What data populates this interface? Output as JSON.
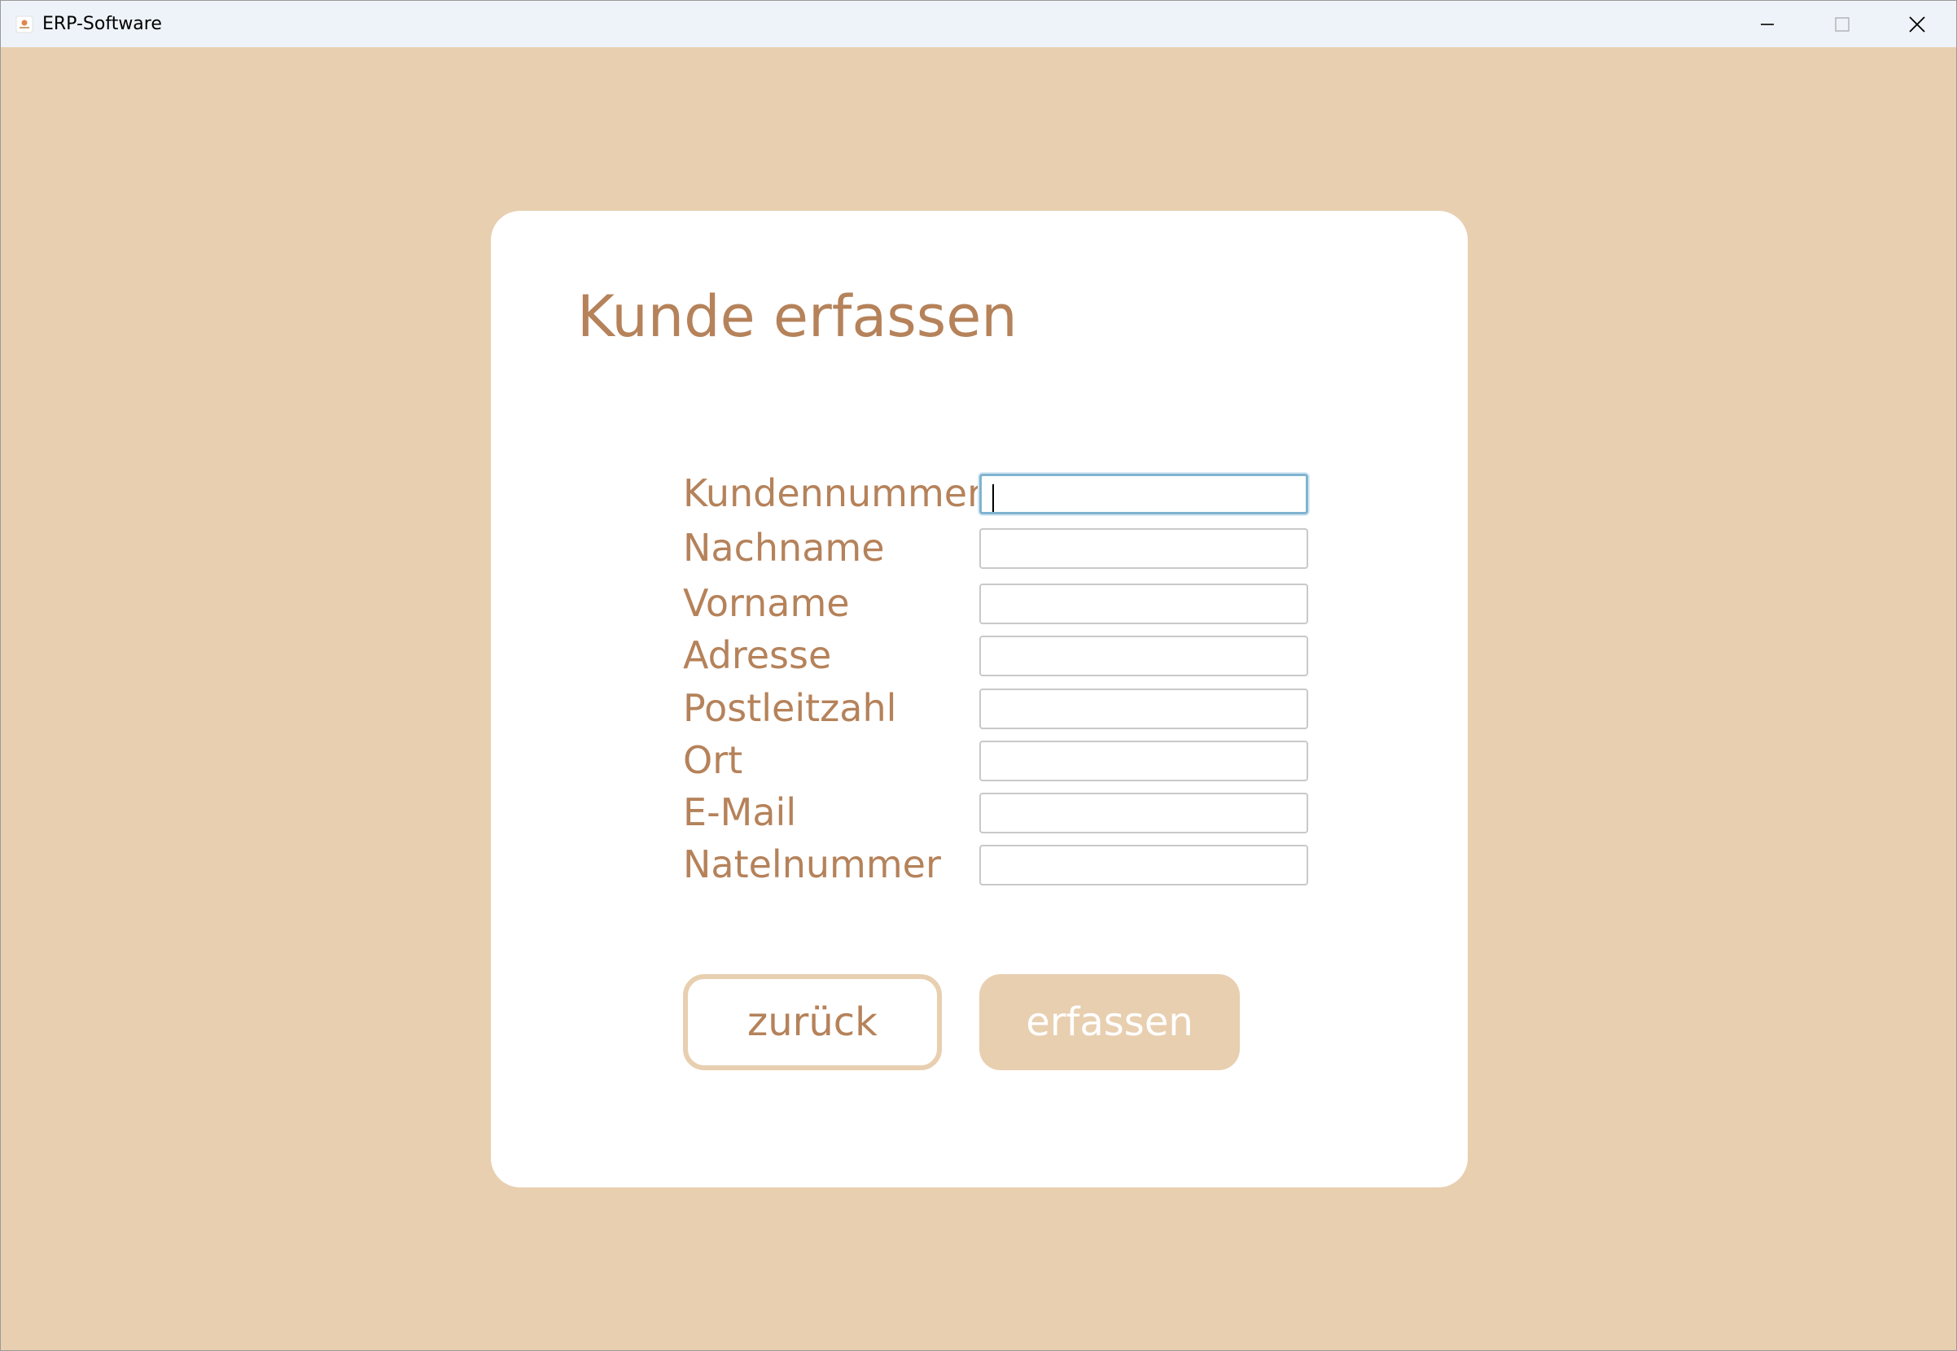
{
  "window": {
    "title": "ERP-Software",
    "app_icon": "erp-app-icon",
    "controls": {
      "minimize_icon": "minimize-icon",
      "maximize_icon": "maximize-icon",
      "close_icon": "close-icon"
    }
  },
  "colors": {
    "background": "#e8cfb0",
    "card": "#ffffff",
    "accent_text": "#b5825a",
    "input_border": "#c9c9c9",
    "focus_border": "#7fb3d0"
  },
  "form": {
    "title": "Kunde erfassen",
    "fields": [
      {
        "label": "Kundennummer",
        "value": "",
        "focused": true
      },
      {
        "label": "Nachname",
        "value": ""
      },
      {
        "label": "Vorname",
        "value": ""
      },
      {
        "label": "Adresse",
        "value": ""
      },
      {
        "label": "Postleitzahl",
        "value": ""
      },
      {
        "label": "Ort",
        "value": ""
      },
      {
        "label": "E-Mail",
        "value": ""
      },
      {
        "label": "Natelnummer",
        "value": ""
      }
    ],
    "buttons": {
      "back_label": "zurück",
      "submit_label": "erfassen"
    }
  }
}
